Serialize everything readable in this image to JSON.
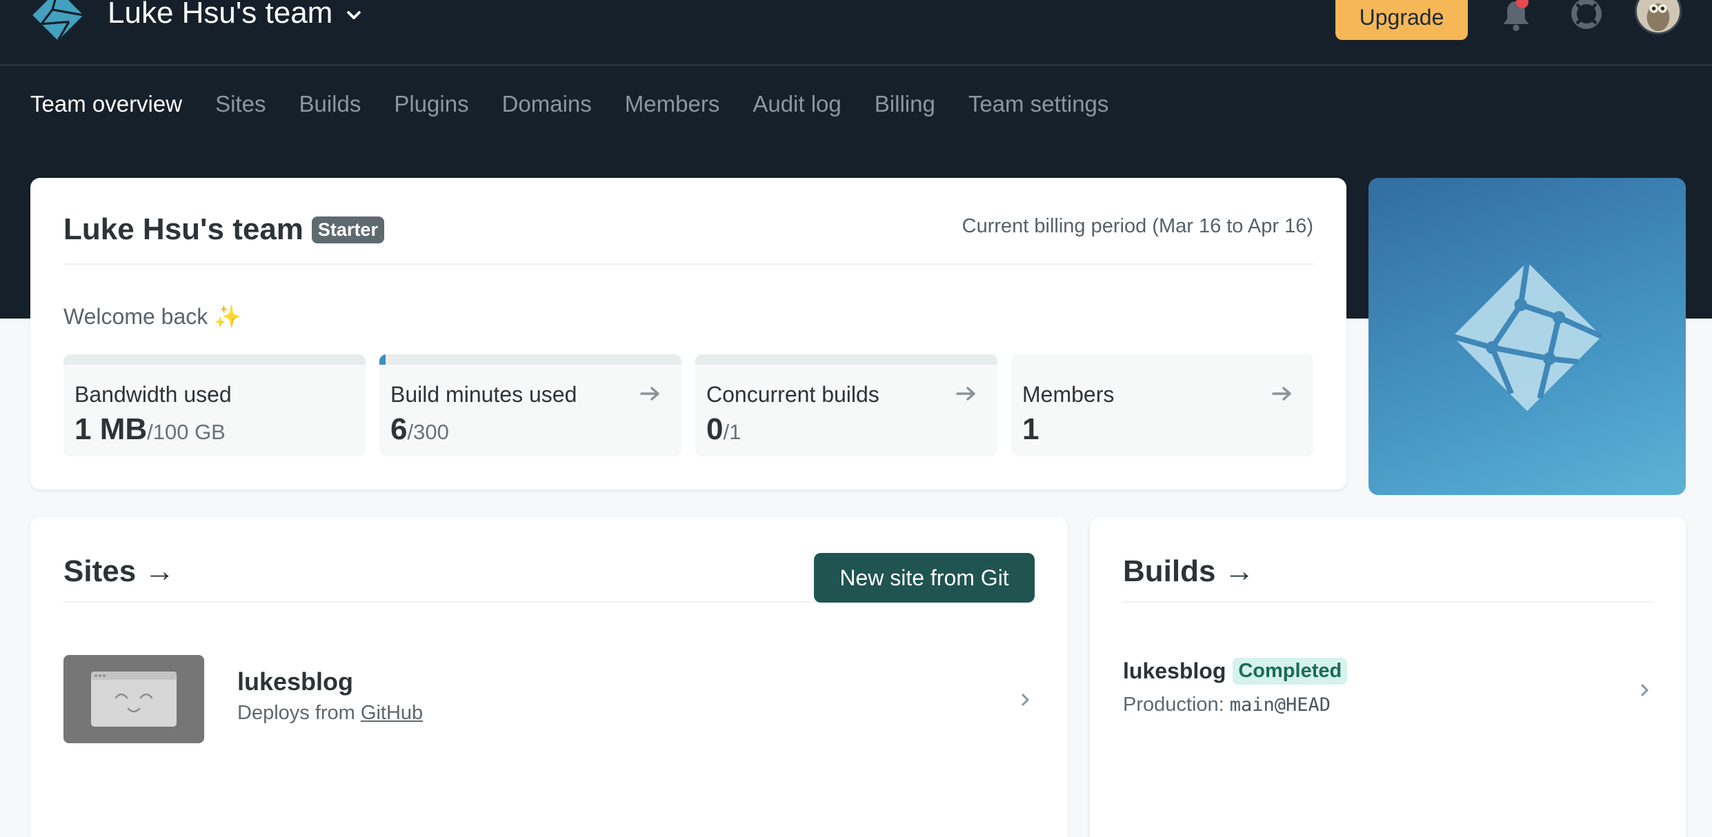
{
  "header": {
    "team_name": "Luke Hsu's team",
    "upgrade_label": "Upgrade"
  },
  "nav": {
    "items": [
      {
        "label": "Team overview",
        "active": true
      },
      {
        "label": "Sites"
      },
      {
        "label": "Builds"
      },
      {
        "label": "Plugins"
      },
      {
        "label": "Domains"
      },
      {
        "label": "Members"
      },
      {
        "label": "Audit log"
      },
      {
        "label": "Billing"
      },
      {
        "label": "Team settings"
      }
    ]
  },
  "overview": {
    "title": "Luke Hsu's team",
    "plan_badge": "Starter",
    "billing_period": "Current billing period (Mar 16 to Apr 16)",
    "welcome": "Welcome back",
    "welcome_emoji": "✨",
    "stats": [
      {
        "label": "Bandwidth used",
        "value": "1 MB",
        "of": "/100 GB",
        "fill_fraction": 0.0
      },
      {
        "label": "Build minutes used",
        "value": "6",
        "of": "/300",
        "fill_fraction": 0.02
      },
      {
        "label": "Concurrent builds",
        "value": "0",
        "of": "/1",
        "fill_fraction": 0.0
      },
      {
        "label": "Members",
        "value": "1",
        "of": ""
      }
    ]
  },
  "sites": {
    "title": "Sites →",
    "new_site_label": "New site from Git",
    "items": [
      {
        "name": "lukesblog",
        "deploys_prefix": "Deploys from",
        "deploys_source": "GitHub"
      }
    ]
  },
  "builds": {
    "title": "Builds →",
    "items": [
      {
        "name": "lukesblog",
        "status": "Completed",
        "context_prefix": "Production:",
        "ref": "main@HEAD"
      }
    ]
  },
  "colors": {
    "header_bg": "#16202a",
    "upgrade_bg": "#f6b756",
    "primary_button": "#1f5450",
    "completed_badge_bg": "#d6f2ec",
    "completed_badge_text": "#1b6b5c",
    "notification_dot": "#e5484d"
  },
  "icons": [
    "netlify-logo-icon",
    "chevron-down-icon",
    "bell-icon",
    "help-lifebuoy-icon",
    "avatar-owl",
    "arrow-right-icon",
    "chevron-right-icon",
    "site-placeholder-icon"
  ]
}
